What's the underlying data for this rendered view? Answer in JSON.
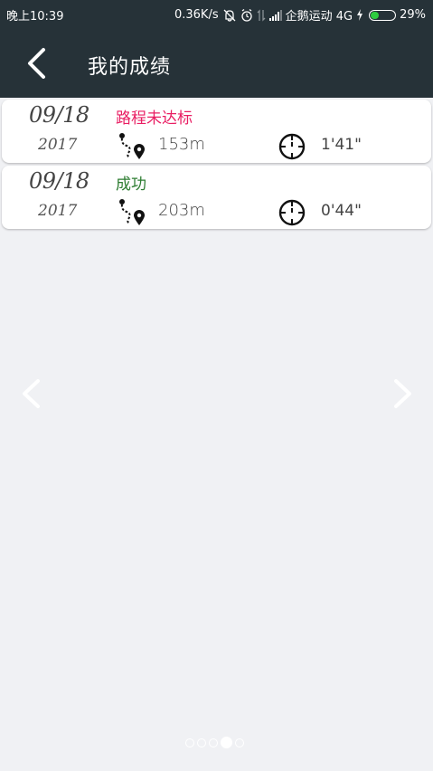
{
  "statusbar": {
    "time": "晚上10:39",
    "speed": "0.36K/s",
    "carrier": "企鹅运动 4G",
    "battery": "29%"
  },
  "appbar": {
    "back_icon": "chevron-left-icon",
    "title": "我的成绩"
  },
  "records": [
    {
      "date": "09/18",
      "year": "2017",
      "status": "路程未达标",
      "status_color": "#e91e63",
      "distance": "153m",
      "duration": "1'41\""
    },
    {
      "date": "09/18",
      "year": "2017",
      "status": "成功",
      "status_color": "#2e7d32",
      "distance": "203m",
      "duration": "0'44\""
    }
  ],
  "pager": {
    "page_count": 5,
    "active_index": 3
  }
}
